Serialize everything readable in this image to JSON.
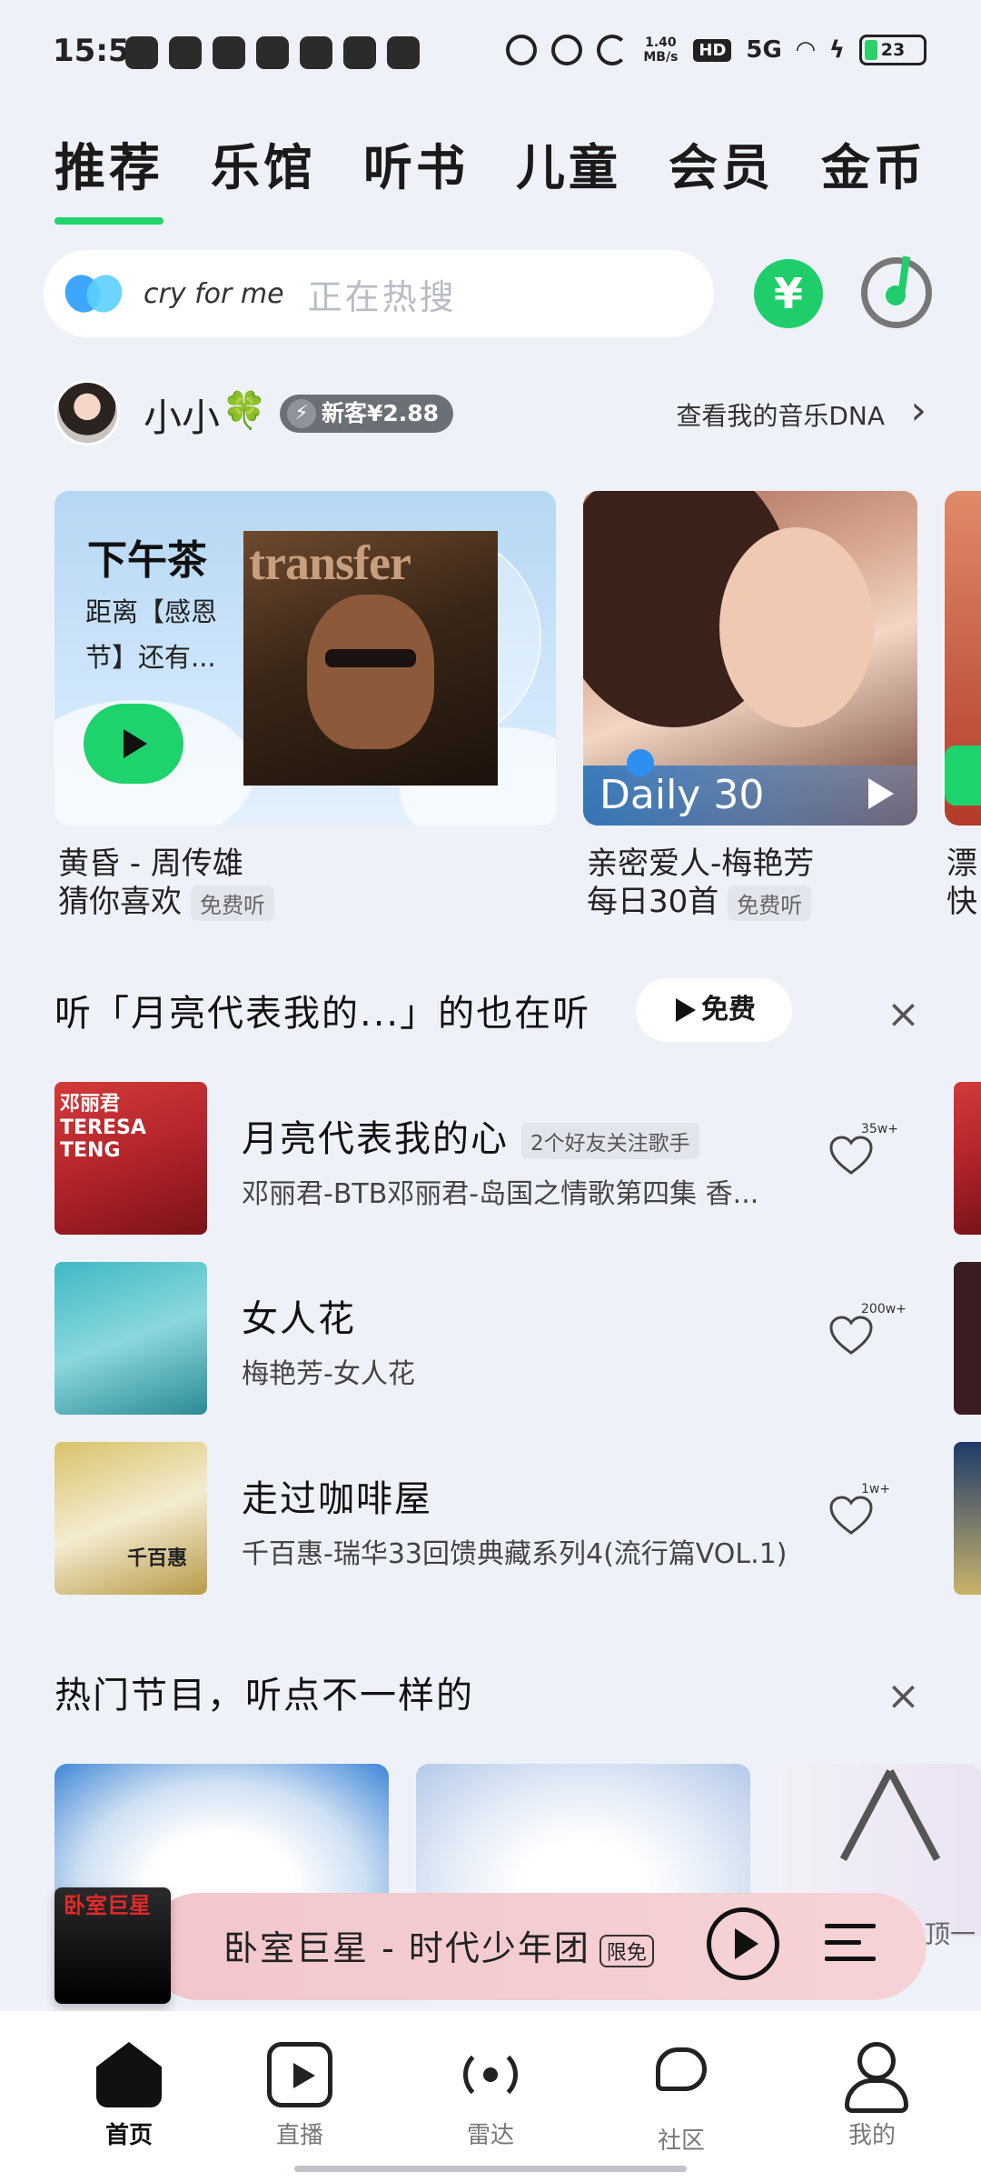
{
  "status_bar": {
    "time": "15:52",
    "net_speed": "1.40 MB/s",
    "hd": "HD",
    "signal": "5G",
    "battery": "23"
  },
  "tabs": [
    "推荐",
    "乐馆",
    "听书",
    "儿童",
    "会员",
    "金币"
  ],
  "active_tab": "推荐",
  "search": {
    "query": "cry for me",
    "placeholder": "正在热搜"
  },
  "coin_button": "¥",
  "user": {
    "name": "小小",
    "clover": "🍀",
    "badge": "新客¥2.88",
    "dna_link": "查看我的音乐DNA"
  },
  "banners": [
    {
      "title": "下午茶",
      "subtitle": "距离【感恩节】还有...",
      "album_text": "transfer",
      "caption_line1": "黄昏 - 周传雄",
      "caption_line2": "猜你喜欢",
      "tag": "免费听"
    },
    {
      "overlay": "Daily 30",
      "caption_line1": "亲密爱人-梅艳芳",
      "caption_line2": "每日30首",
      "tag": "免费听"
    },
    {
      "caption_line1": "漂",
      "caption_line2": "快"
    }
  ],
  "section1": {
    "title": "听「月亮代表我的...」的也在听",
    "free_button": "免费",
    "songs": [
      {
        "title": "月亮代表我的心",
        "tag": "2个好友关注歌手",
        "meta": "邓丽君-BTB邓丽君-岛国之情歌第四集 香...",
        "likes": "35w+",
        "cover_label": "邓丽君 TERESA TENG"
      },
      {
        "title": "女人花",
        "tag": "",
        "meta": "梅艳芳-女人花",
        "likes": "200w+",
        "cover_label": ""
      },
      {
        "title": "走过咖啡屋",
        "tag": "",
        "meta": "千百惠-瑞华33回馈典藏系列4(流行篇VOL.1)",
        "likes": "1w+",
        "cover_label": "千百惠"
      }
    ]
  },
  "section2": {
    "title": "热门节目，听点不一样的"
  },
  "mini_player": {
    "title": "卧室巨星 - 时代少年团",
    "limit_tag": "限免",
    "art_text": "卧室巨星",
    "peek_text": "顶一"
  },
  "bottom_nav": [
    {
      "label": "首页",
      "icon": "home-icon"
    },
    {
      "label": "直播",
      "icon": "live-icon"
    },
    {
      "label": "雷达",
      "icon": "radar-icon"
    },
    {
      "label": "社区",
      "icon": "community-icon"
    },
    {
      "label": "我的",
      "icon": "profile-icon"
    }
  ],
  "colors": {
    "accent": "#1fce6a",
    "background": "#eef2f8"
  }
}
